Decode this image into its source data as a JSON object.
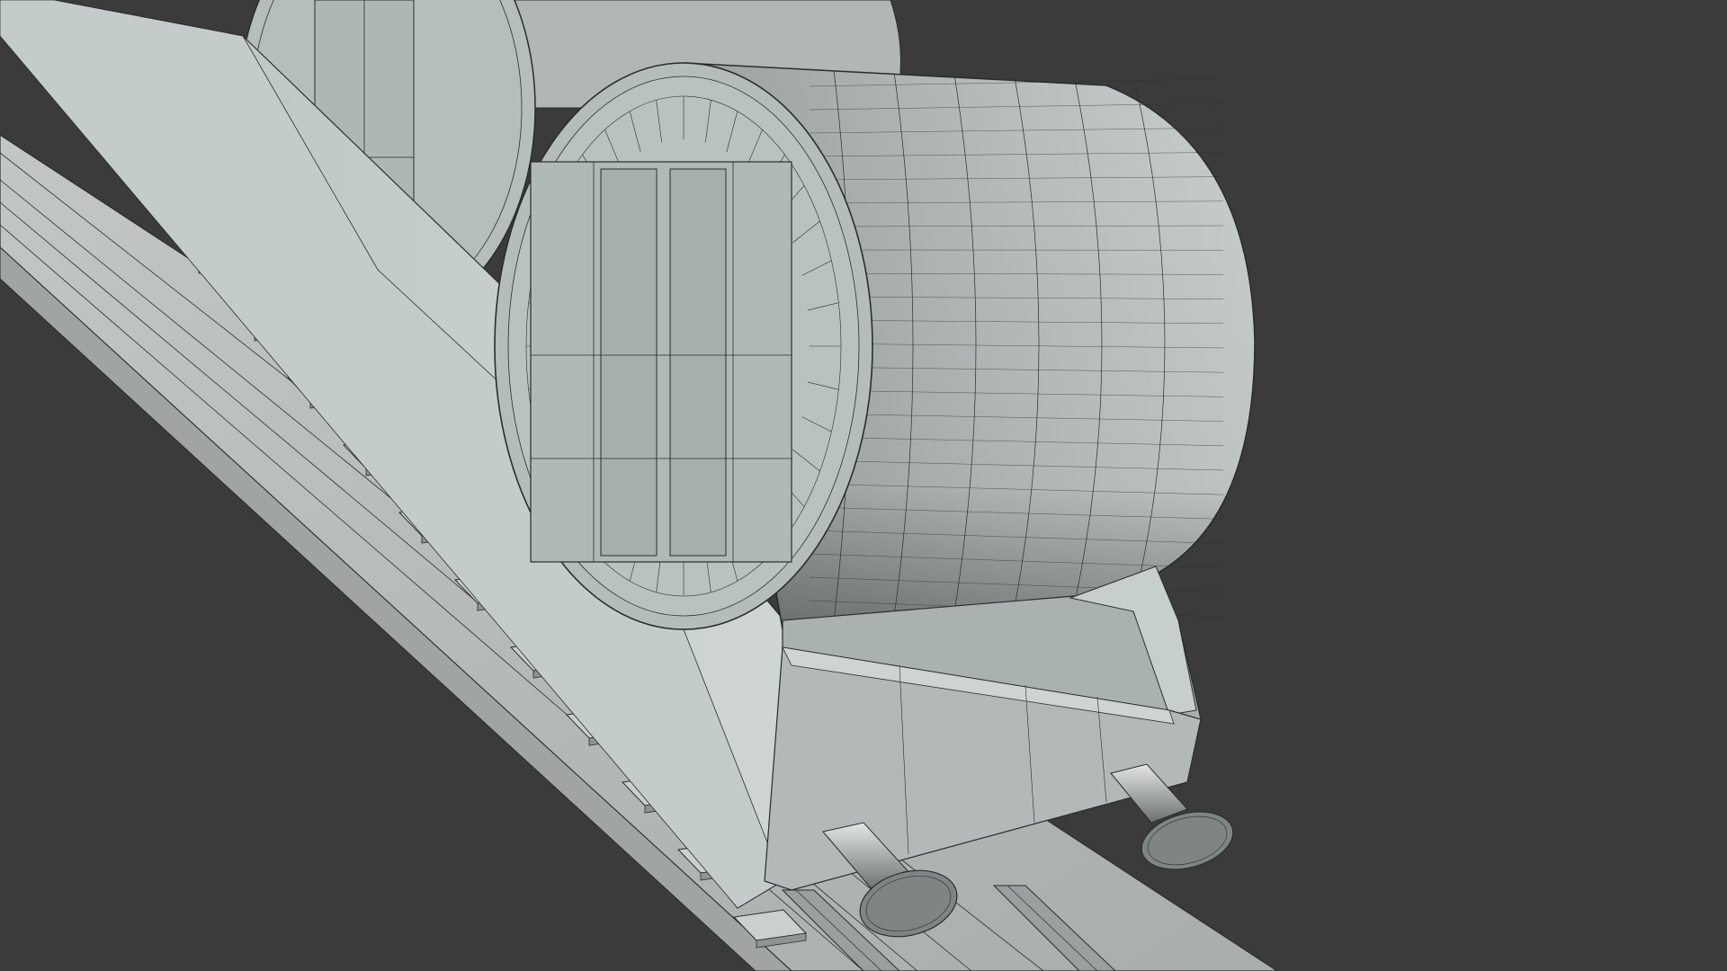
{
  "scene": {
    "subject": "wireframe-train-wagon-with-barrels",
    "colors": {
      "background": "#3b3b3b",
      "surface_light": "#c9d0cf",
      "surface_mid": "#aeb5b4",
      "surface_dark": "#8a908f",
      "wire": "#2a2d2d",
      "track_bed": "#b4b8b6",
      "rail": "#9aa09f"
    }
  }
}
